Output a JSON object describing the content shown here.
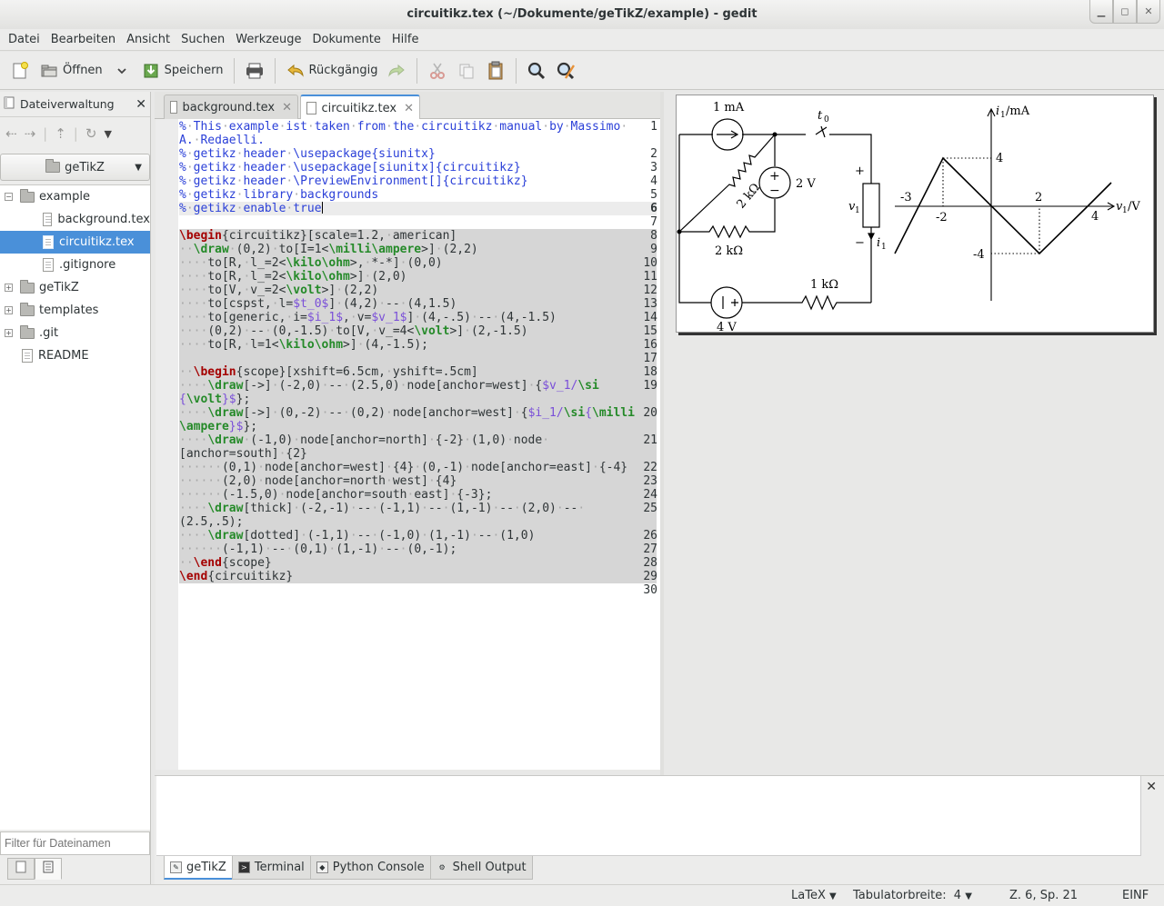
{
  "window": {
    "title": "circuitikz.tex (~/Dokumente/geTikZ/example) - gedit"
  },
  "menu": [
    "Datei",
    "Bearbeiten",
    "Ansicht",
    "Suchen",
    "Werkzeuge",
    "Dokumente",
    "Hilfe"
  ],
  "toolbar": {
    "open_label": "Öffnen",
    "save_label": "Speichern",
    "undo_label": "Rückgängig"
  },
  "sidebar": {
    "title": "Dateiverwaltung",
    "location": "geTikZ",
    "tree": [
      {
        "label": "example",
        "type": "folder",
        "expanded": true
      },
      {
        "label": "background.tex",
        "type": "file"
      },
      {
        "label": "circuitikz.tex",
        "type": "file",
        "selected": true
      },
      {
        "label": ".gitignore",
        "type": "file"
      },
      {
        "label": "geTikZ",
        "type": "folder"
      },
      {
        "label": "templates",
        "type": "folder"
      },
      {
        "label": ".git",
        "type": "folder"
      },
      {
        "label": "README",
        "type": "file"
      }
    ],
    "filter_placeholder": "Filter für Dateinamen"
  },
  "tabs": [
    {
      "label": "background.tex",
      "active": false
    },
    {
      "label": "circuitikz.tex",
      "active": true
    }
  ],
  "editor": {
    "line_numbers": [
      "1",
      "2",
      "3",
      "4",
      "5",
      "6",
      "7",
      "8",
      "9",
      "10",
      "11",
      "12",
      "13",
      "14",
      "15",
      "16",
      "17",
      "18",
      "19",
      "20",
      "21",
      "22",
      "23",
      "24",
      "25",
      "26",
      "27",
      "28",
      "29",
      "30"
    ],
    "current_line": 6
  },
  "preview": {
    "labels": {
      "src_current": "1 mA",
      "src_voltage_top": "2 V",
      "src_voltage_bottom": "4 V",
      "switch_time": "t",
      "switch_time_sub": "0",
      "res_diag": "2 kΩ",
      "res_horiz": "2 kΩ",
      "res_bottom": "1 kΩ",
      "generic_v": "v",
      "generic_v_sub": "1",
      "generic_i": "i",
      "generic_i_sub": "1",
      "plus": "+",
      "minus": "−",
      "y_axis": "i",
      "y_axis_sub": "1",
      "y_axis_unit": "/mA",
      "x_axis": "v",
      "x_axis_sub": "1",
      "x_axis_unit": "/V",
      "tick_4": "4",
      "tick_m4": "-4",
      "tick_2": "2",
      "tick_m2": "-2",
      "tick_m3": "-3",
      "tick_x4": "4"
    }
  },
  "bottom_panel": {
    "tabs": [
      "geTikZ",
      "Terminal",
      "Python Console",
      "Shell Output"
    ],
    "active": "geTikZ"
  },
  "status": {
    "language": "LaTeX",
    "tab_width_label": "Tabulatorbreite:",
    "tab_width": "4",
    "position": "Z. 6, Sp. 21",
    "mode": "EINF"
  }
}
